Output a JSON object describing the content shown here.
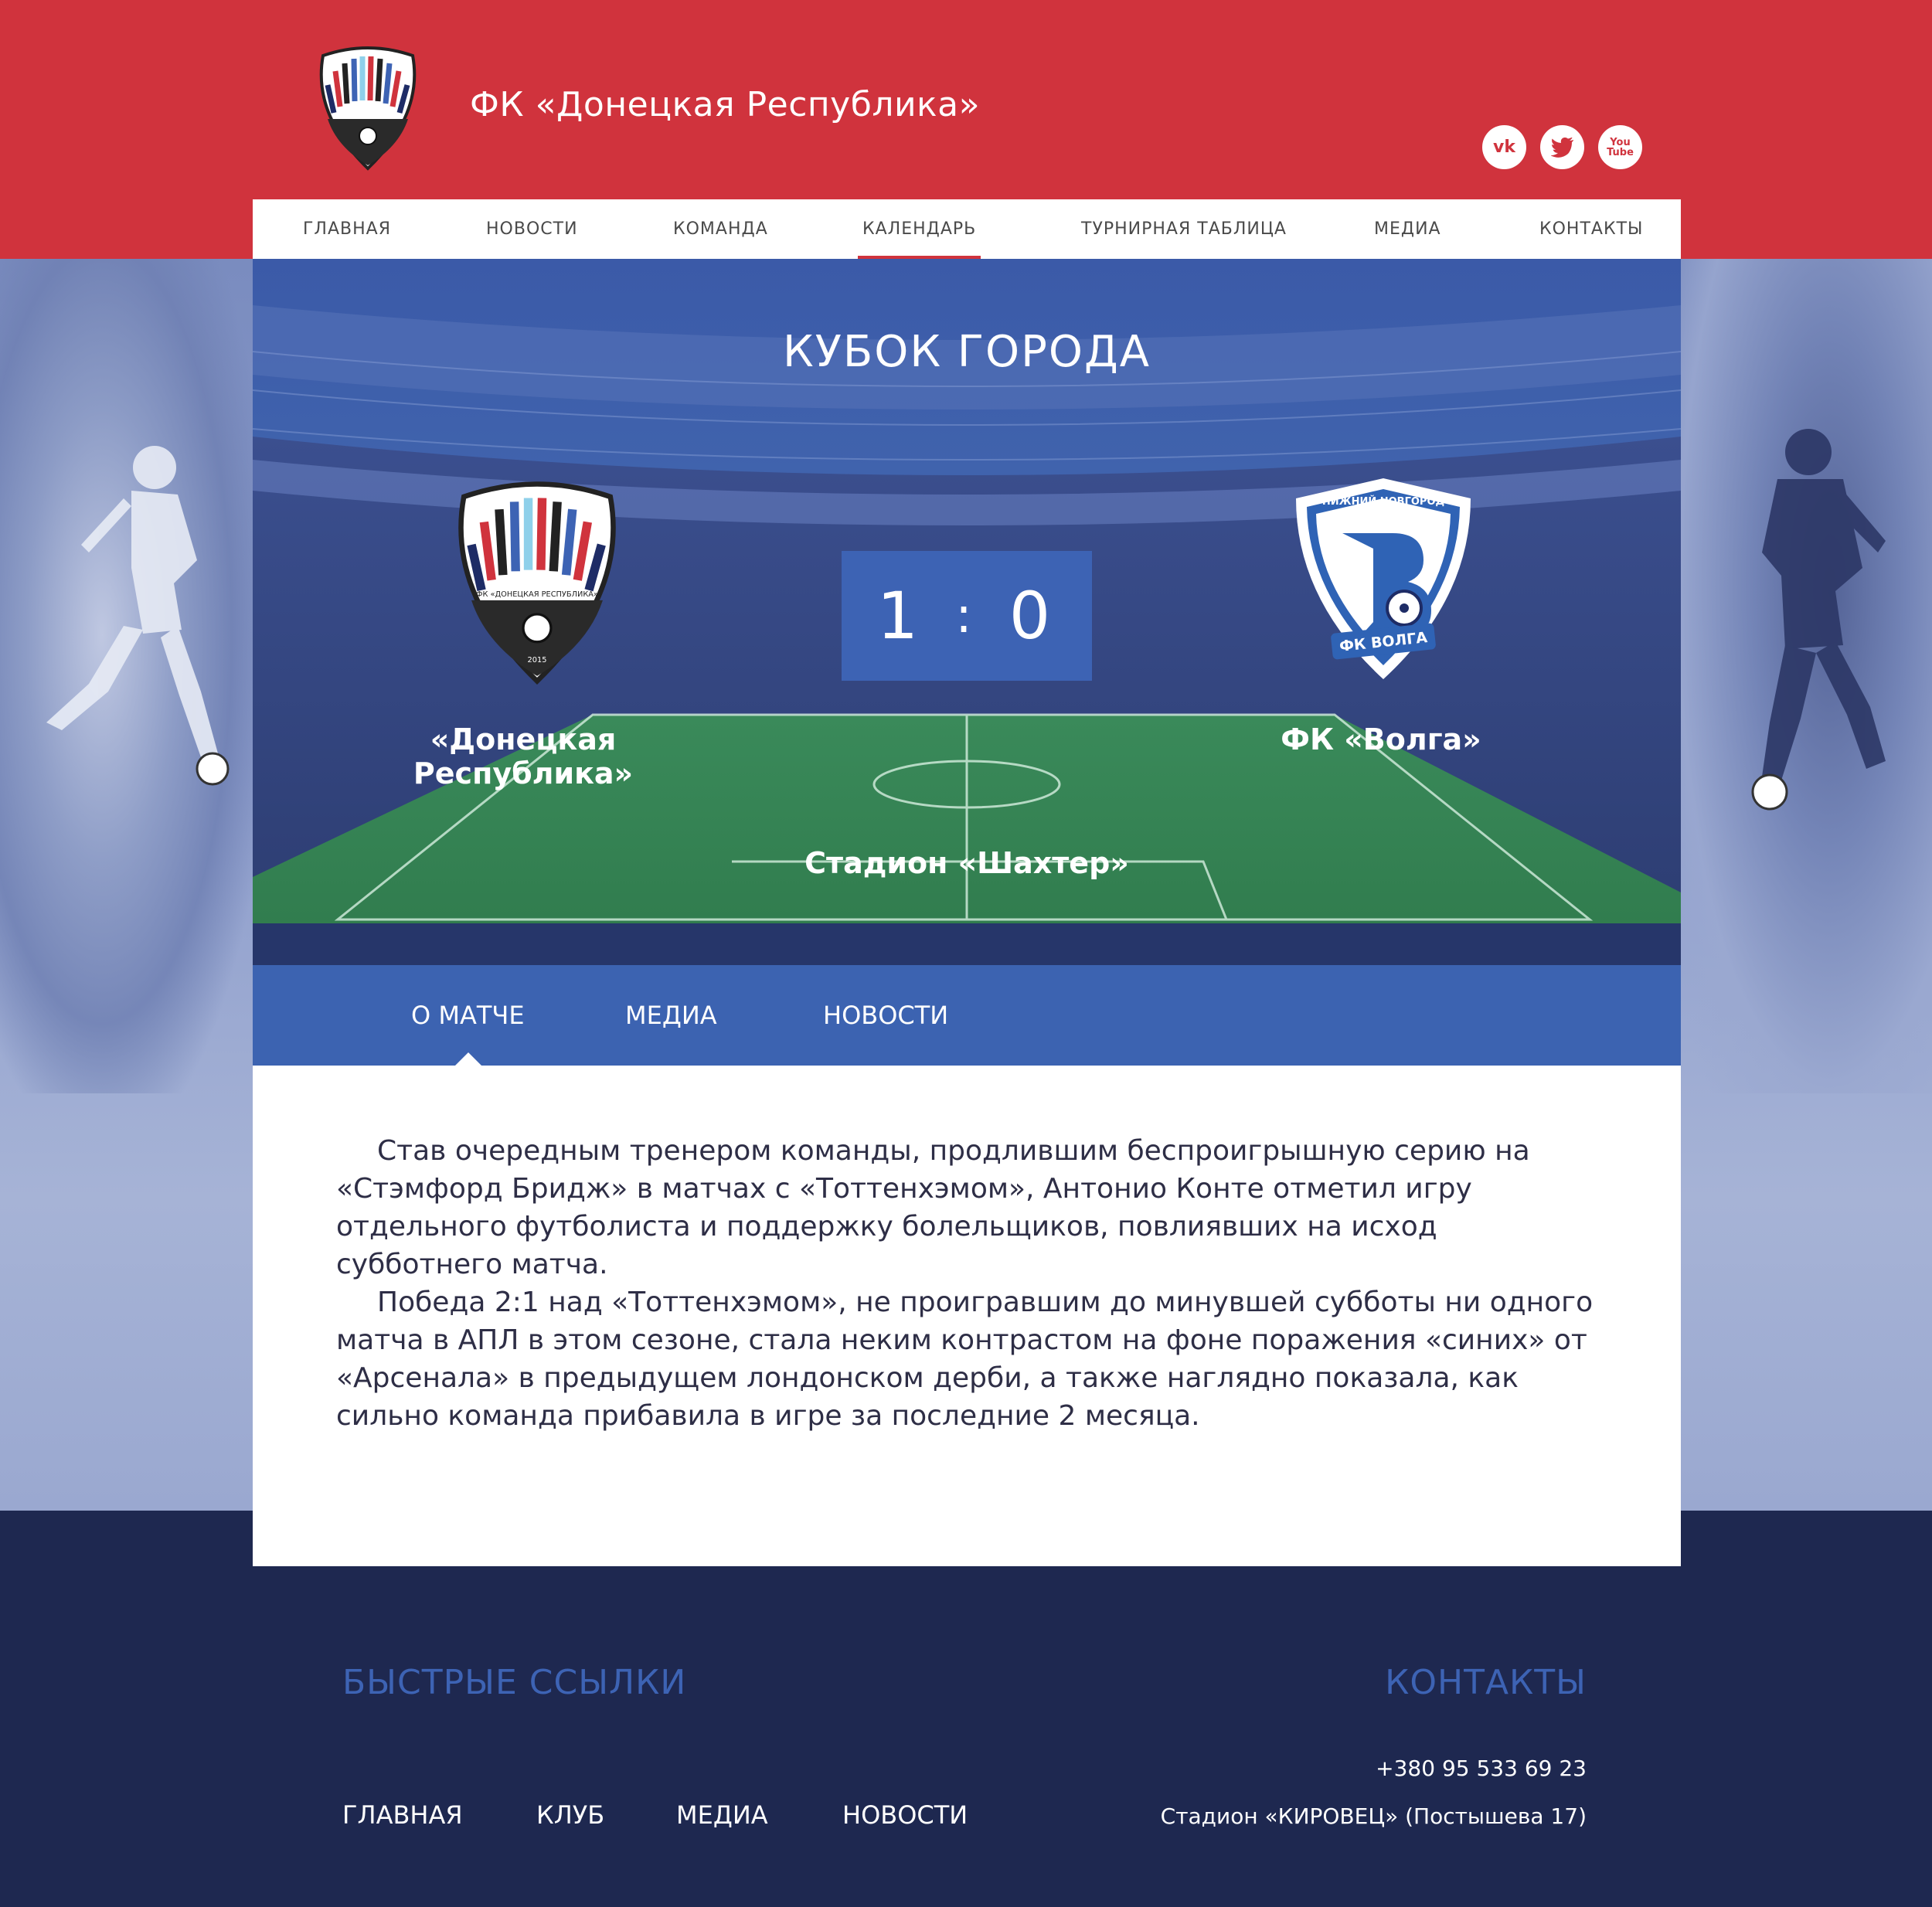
{
  "header": {
    "title": "ФК «Донецкая Республика»",
    "logo_text": "ФК «ДОНЕЦКАЯ РЕСПУБЛИКА»",
    "logo_year": "2015",
    "socials": [
      {
        "name": "vk",
        "label": "vk"
      },
      {
        "name": "twitter",
        "label": "t"
      },
      {
        "name": "youtube",
        "label": "You Tube"
      }
    ]
  },
  "nav": {
    "items": [
      "ГЛАВНАЯ",
      "НОВОСТИ",
      "КОМАНДА",
      "КАЛЕНДАРЬ",
      "ТУРНИРНАЯ ТАБЛИЦА",
      "МЕДИА",
      "КОНТАКТЫ"
    ],
    "active": "КАЛЕНДАРЬ"
  },
  "match": {
    "tournament": "КУБОК ГОРОДА",
    "home_team": "«Донецкая Республика»",
    "away_team": "ФК «Волга»",
    "home_score": "1",
    "away_score": "0",
    "separator": ":",
    "stadium": "Стадион «Шахтер»",
    "away_logo_top": "НИЖНИЙ НОВГОРОД",
    "away_logo_bottom": "ФК ВОЛГА"
  },
  "tabs": {
    "items": [
      "О МАТЧЕ",
      "МЕДИА",
      "НОВОСТИ"
    ],
    "active": "О МАТЧЕ"
  },
  "article": {
    "paragraphs": [
      "Став очередным тренером команды, продлившим беспроигрышную серию на «Стэмфорд Бридж» в матчах с «Тоттенхэмом», Антонио Конте отметил игру отдельного футболиста и поддержку болельщиков, повлиявших на исход субботнего матча.",
      "Победа 2:1 над «Тоттенхэмом», не проигравшим до минувшей субботы ни одного матча в АПЛ в этом сезоне, стала неким контрастом на фоне поражения «синих» от «Арсенала» в предыдущем лондонском дерби, а также наглядно показала, как сильно команда прибавила в игре за последние 2 месяца."
    ]
  },
  "footer": {
    "links_heading": "БЫСТРЫЕ ССЫЛКИ",
    "contacts_heading": "КОНТАКТЫ",
    "links": [
      "ГЛАВНАЯ",
      "КЛУБ",
      "МЕДИА",
      "НОВОСТИ"
    ],
    "phone": "+380 95 533 69 23",
    "address": "Стадион «КИРОВЕЦ» (Постышева 17)"
  },
  "colors": {
    "brand_red": "#d0333d",
    "brand_blue": "#3c63b1",
    "footer_navy": "#1e2850"
  }
}
